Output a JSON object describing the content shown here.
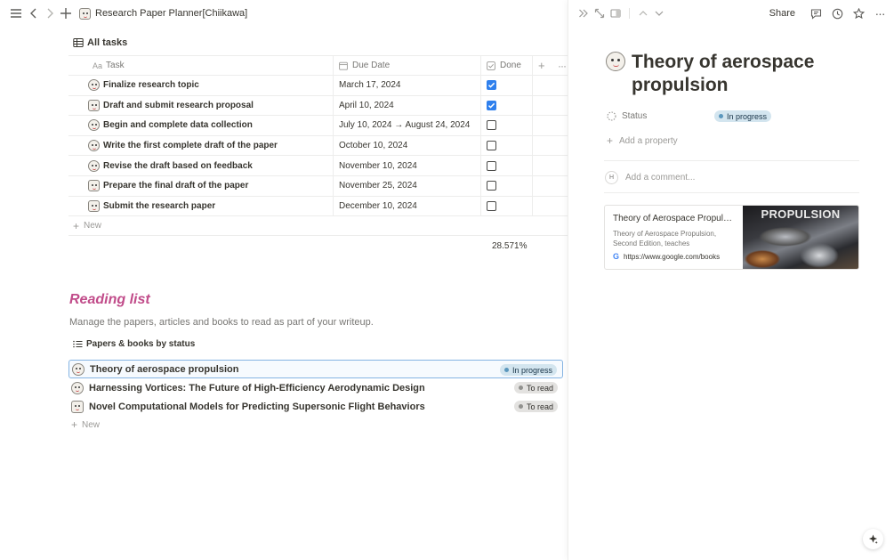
{
  "topbar": {
    "breadcrumb": "Research Paper Planner[Chiikawa]"
  },
  "tasks_view": {
    "tab_label": "All tasks",
    "columns": {
      "task": "Task",
      "due": "Due Date",
      "done": "Done"
    },
    "rows": [
      {
        "task": "Finalize research topic",
        "due": "March 17, 2024",
        "done": true
      },
      {
        "task": "Draft and submit research proposal",
        "due": "April 10, 2024",
        "done": true
      },
      {
        "task": "Begin and complete data collection",
        "due": "July 10, 2024 → August 24, 2024",
        "done": false
      },
      {
        "task": "Write the first complete draft of the paper",
        "due": "October 10, 2024",
        "done": false
      },
      {
        "task": "Revise the draft based on feedback",
        "due": "November 10, 2024",
        "done": false
      },
      {
        "task": "Prepare the final draft of the paper",
        "due": "November 25, 2024",
        "done": false
      },
      {
        "task": "Submit the research paper",
        "due": "December 10, 2024",
        "done": false
      }
    ],
    "new_label": "New",
    "calc_value": "28.571%"
  },
  "reading": {
    "title": "Reading list",
    "description": "Manage the papers, articles and books to read as part of your writeup.",
    "tab_label": "Papers & books by status",
    "items": [
      {
        "title": "Theory of aerospace propulsion",
        "status": "In progress"
      },
      {
        "title": "Harnessing Vortices: The Future of High-Efficiency Aerodynamic Design",
        "status": "To read"
      },
      {
        "title": "Novel Computational Models for Predicting Supersonic Flight Behaviors",
        "status": "To read"
      }
    ],
    "new_label": "New"
  },
  "peek": {
    "share_label": "Share",
    "title": "Theory of aerospace propulsion",
    "status_label": "Status",
    "status_value": "In progress",
    "add_property": "Add a property",
    "avatar_initial": "H",
    "comment_placeholder": "Add a comment...",
    "bookmark": {
      "title": "Theory of Aerospace Propulsion",
      "description": "Theory of Aerospace Propulsion, Second Edition, teaches",
      "url": "https://www.google.com/books",
      "image_word": "PROPULSION"
    }
  },
  "colors": {
    "accent_blue": "#2f80ed",
    "reading_title": "#c14c8a",
    "in_progress_bg": "#d3e5ef",
    "to_read_bg": "#e3e2e0"
  }
}
